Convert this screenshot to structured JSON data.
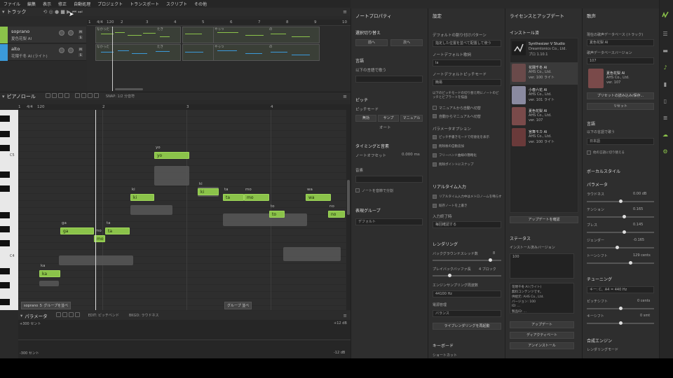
{
  "menu": [
    "ファイル",
    "編集",
    "表示",
    "修正",
    "自動処理",
    "プロジェクト",
    "トランスポート",
    "スクリプト",
    "その他"
  ],
  "tracks": {
    "title": "トラック",
    "items": [
      {
        "name": "soprano",
        "voice": "夏色花梨 AI",
        "color": "#8bc34a"
      },
      {
        "name": "alto",
        "voice": "花隈千冬 AI (ライト)",
        "color": "#3b9ad9"
      }
    ],
    "ruler": [
      "1",
      "4/4",
      "120",
      "2",
      "3",
      "4",
      "5",
      "6",
      "7",
      "8",
      "9",
      "10"
    ],
    "clip_lyrics": [
      "なかった",
      "たき",
      "やっつ",
      "の"
    ],
    "clip_lyrics2": [
      "なかった",
      "たき",
      "やっつ",
      "の"
    ]
  },
  "pianoroll": {
    "title": "ピアノロール",
    "snap": "SNAP: 1/2 分音符",
    "ruler": [
      "1",
      "4/4",
      "120",
      "2",
      "3",
      "4"
    ],
    "key_labels": [
      "C5",
      "C4"
    ],
    "notes": [
      "ka",
      "ga",
      "mo",
      "ta",
      "ki",
      "yo",
      "ki",
      "ta",
      "mo",
      "to",
      "wa",
      "no"
    ],
    "lyrics": [
      "ka",
      "ga",
      "mo",
      "ta",
      "ki",
      "yo",
      "ki",
      "ta",
      "mo",
      "to",
      "wa",
      "no"
    ],
    "group_tag1": "soprano ５ グループを並べ",
    "group_tag2": "グループ 並べ"
  },
  "params": {
    "title": "パラメータ",
    "edit": "EDIT: ピッチベンド",
    "bkgd": "BKGD: ラウドネス",
    "top_val": "+300 セント",
    "bottom_val": "-300 セント",
    "right_top": "+12 dB",
    "right_bottom": "-12 dB"
  },
  "noteprops": {
    "title": "ノートプロパティ",
    "sel": "選択切り替え",
    "prev": "前へ",
    "next": "次へ",
    "lyrics_hdr": "言語",
    "lang_label": "以下の言語で歌う",
    "pitch_hdr": "ピッチ",
    "pitch_mode": "ピッチモード",
    "modes": [
      "無効",
      "サンプ",
      "マニュアル"
    ],
    "auto": "オート",
    "timing_hdr": "タイミングと音素",
    "note_offset": "ノートオフセット",
    "offset_val": "0.000 ms",
    "phoneme": "音素",
    "phoneme_chk": "ノートを音節で分割",
    "group_hdr": "表現グループ",
    "default": "デフォルト"
  },
  "settings": {
    "title": "設定",
    "default_pattern": "デフォルトの割り付けパターン",
    "pattern_val": "指定した位置を並べて配置して使う",
    "note_default": "ノートデフォルト歌詞",
    "note_val": "la",
    "pitch_default": "ノートデフォルトピッチモード",
    "pitch_val": "簡易",
    "desc": "以下のピッチモードの切り替え時にノートのピッチとビブラートを描画",
    "chk": [
      "マニュアルから自動へ切替",
      "自動からマニュアルへ切替"
    ],
    "param_hdr": "パラメータオプション",
    "param_chk": [
      "ピッチ手書きモードで何値化を表示",
      "削除後の自動追加",
      "フリーハンド曲線の簡略化",
      "削除ポイントにスナップ"
    ],
    "realtime_hdr": "リアルタイム入力",
    "rt_chk": [
      "リアルタイム入力中はメトロノームを鳴らす",
      "既存ノートを上書き"
    ],
    "input_end": "入力終了時",
    "input_val": "毎回確認する",
    "render_hdr": "レンダリング",
    "bg_threads": "バックグラウンドスレッド数",
    "bg_val": "8",
    "playback": "プレイバックバッファ長",
    "pb_val": "4 ブロック",
    "engine_sr": "エンジンサンプリング周波数",
    "sr_val": "44100 Hz",
    "low_mgmt": "電源管理",
    "low_val": "バランス",
    "reset_btn": "ライブレンダリングを再起動",
    "keyboard_hdr": "キーボード",
    "shortcut": "ショートカット"
  },
  "license": {
    "title": "ライセンスとアップデート",
    "installed": "インストール済",
    "items": [
      {
        "name": "Synthesizer V Studio",
        "vendor": "Dreamtonics Co., Ltd.",
        "ver": "プロ 1.10.1"
      },
      {
        "name": "花隈千冬 AI",
        "vendor": "AHS Co., Ltd.",
        "ver": "ver. 100 ライト"
      },
      {
        "name": "小春六花 AI",
        "vendor": "AHS Co., Ltd.",
        "ver": "ver. 101 ライト"
      },
      {
        "name": "夏色花梨 AI",
        "vendor": "AHS Co., Ltd.",
        "ver": "ver. 107"
      },
      {
        "name": "宮舞モカ AI",
        "vendor": "AHS Co., Ltd.",
        "ver": "ver. 100 ライト"
      }
    ],
    "check_btn": "アップデートを確認",
    "status_hdr": "ステータス",
    "install_ver": "インストール済みバージョン",
    "ver_val": "100",
    "info_lines": [
      "花隈千冬 AI (ライト)",
      "無料コンテンツです。",
      "供給元: AHS Co., Ltd.",
      "バージョン: 100",
      "ID: ...",
      "製品ID: ..."
    ],
    "update_btn": "アップデート",
    "deactivate_btn": "ディアクティベート",
    "uninstall_btn": "アンインストール"
  },
  "voice": {
    "title": "歌声",
    "cur_db": "現在の歌声データベース (トラック)",
    "db_val": "夏色花梨 AI",
    "db_ver": "歌声データベースバージョン",
    "ver_val": "107",
    "card_name": "夏色花梨 AI",
    "card_vendor": "AHS Co., Ltd.",
    "card_ver": "ver. 107",
    "preset_btn": "プリセットの読み込み/保存...",
    "reset_btn": "リセット",
    "lang_hdr": "言語",
    "lang_label": "以下の言語で歌う",
    "lang_val": "日本語",
    "lang_chk": "他の言語に切り替える",
    "vocal_hdr": "ボーカルスタイル",
    "param_hdr": "パラメータ",
    "params": [
      {
        "name": "ラウドネス",
        "val": "0.00 dB",
        "pos": 0.5
      },
      {
        "name": "テンション",
        "val": "0.165",
        "pos": 0.55
      },
      {
        "name": "ブレス",
        "val": "0.145",
        "pos": 0.55
      },
      {
        "name": "ジェンダー",
        "val": "-0.165",
        "pos": 0.45
      },
      {
        "name": "トーンシフト",
        "val": "129 cents",
        "pos": 0.65
      }
    ],
    "tuning_hdr": "チューニング",
    "tuning_val": "キー: C、A4 = 440 Hz",
    "pitch_shift": "ピッチシフト",
    "ps_val": "0 cents",
    "key_shift": "キーシフト",
    "ks_val": "0 smt",
    "synth_hdr": "合成エンジン",
    "render_mode": "レンダリングモード"
  },
  "colors": {
    "accent": "#8bc34a",
    "alto": "#3b9ad9"
  }
}
